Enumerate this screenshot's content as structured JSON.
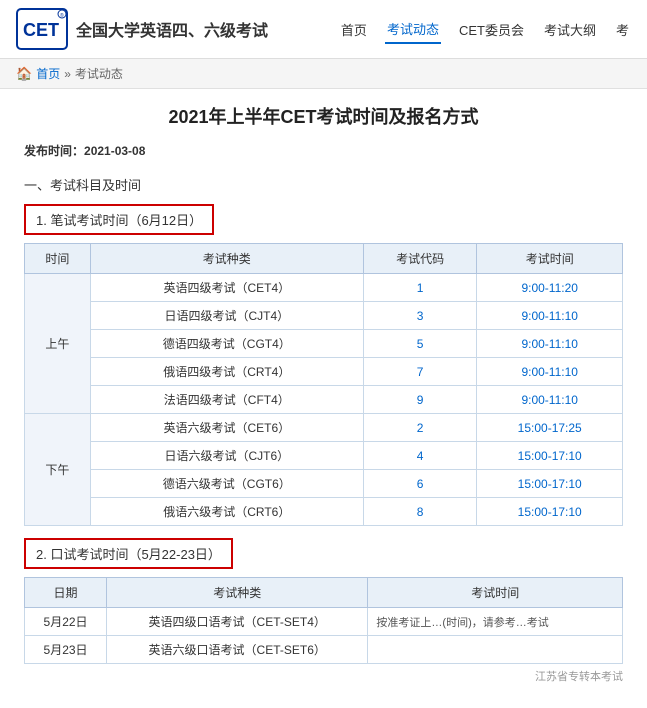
{
  "header": {
    "logo_text": "CET",
    "site_title": "全国大学英语四、六级考试",
    "nav_items": [
      {
        "label": "首页",
        "active": false
      },
      {
        "label": "考试动态",
        "active": true
      },
      {
        "label": "CET委员会",
        "active": false
      },
      {
        "label": "考试大纲",
        "active": false
      },
      {
        "label": "考",
        "active": false
      }
    ]
  },
  "breadcrumb": {
    "home": "首页",
    "separator": "»",
    "current": "考试动态"
  },
  "article": {
    "title": "2021年上半年CET考试时间及报名方式",
    "publish_label": "发布时间：",
    "publish_date": "2021-03-08",
    "section1_title": "一、考试科目及时间",
    "written_label": "1. 笔试考试时间（6月12日）",
    "oral_label": "2. 口试考试时间（5月22-23日）"
  },
  "written_table": {
    "headers": [
      "时间",
      "考试种类",
      "考试代码",
      "考试时间"
    ],
    "rows": [
      {
        "period": "上午",
        "type": "英语四级考试（CET4）",
        "code": "1",
        "time": "9:00-11:20",
        "rowspan": 5
      },
      {
        "period": "",
        "type": "日语四级考试（CJT4）",
        "code": "3",
        "time": "9:00-11:10"
      },
      {
        "period": "",
        "type": "德语四级考试（CGT4）",
        "code": "5",
        "time": "9:00-11:10"
      },
      {
        "period": "",
        "type": "俄语四级考试（CRT4）",
        "code": "7",
        "time": "9:00-11:10"
      },
      {
        "period": "",
        "type": "法语四级考试（CFT4）",
        "code": "9",
        "time": "9:00-11:10"
      },
      {
        "period": "下午",
        "type": "英语六级考试（CET6）",
        "code": "2",
        "time": "15:00-17:25",
        "rowspan": 4
      },
      {
        "period": "",
        "type": "日语六级考试（CJT6）",
        "code": "4",
        "time": "15:00-17:10"
      },
      {
        "period": "",
        "type": "德语六级考试（CGT6）",
        "code": "6",
        "time": "15:00-17:10"
      },
      {
        "period": "",
        "type": "俄语六级考试（CRT6）",
        "code": "8",
        "time": "15:00-17:10"
      }
    ]
  },
  "oral_table": {
    "headers": [
      "日期",
      "考试种类",
      "考试时间"
    ],
    "rows": [
      {
        "date": "5月22日",
        "type": "英语四级口语考试（CET-SET4）",
        "note": "按准考证上…(时间)悠,请参考…考试"
      },
      {
        "date": "5月23日",
        "type": "英语六级口语考试（CET-SET6）",
        "note": ""
      }
    ]
  },
  "watermark": "江苏省专转本考试"
}
